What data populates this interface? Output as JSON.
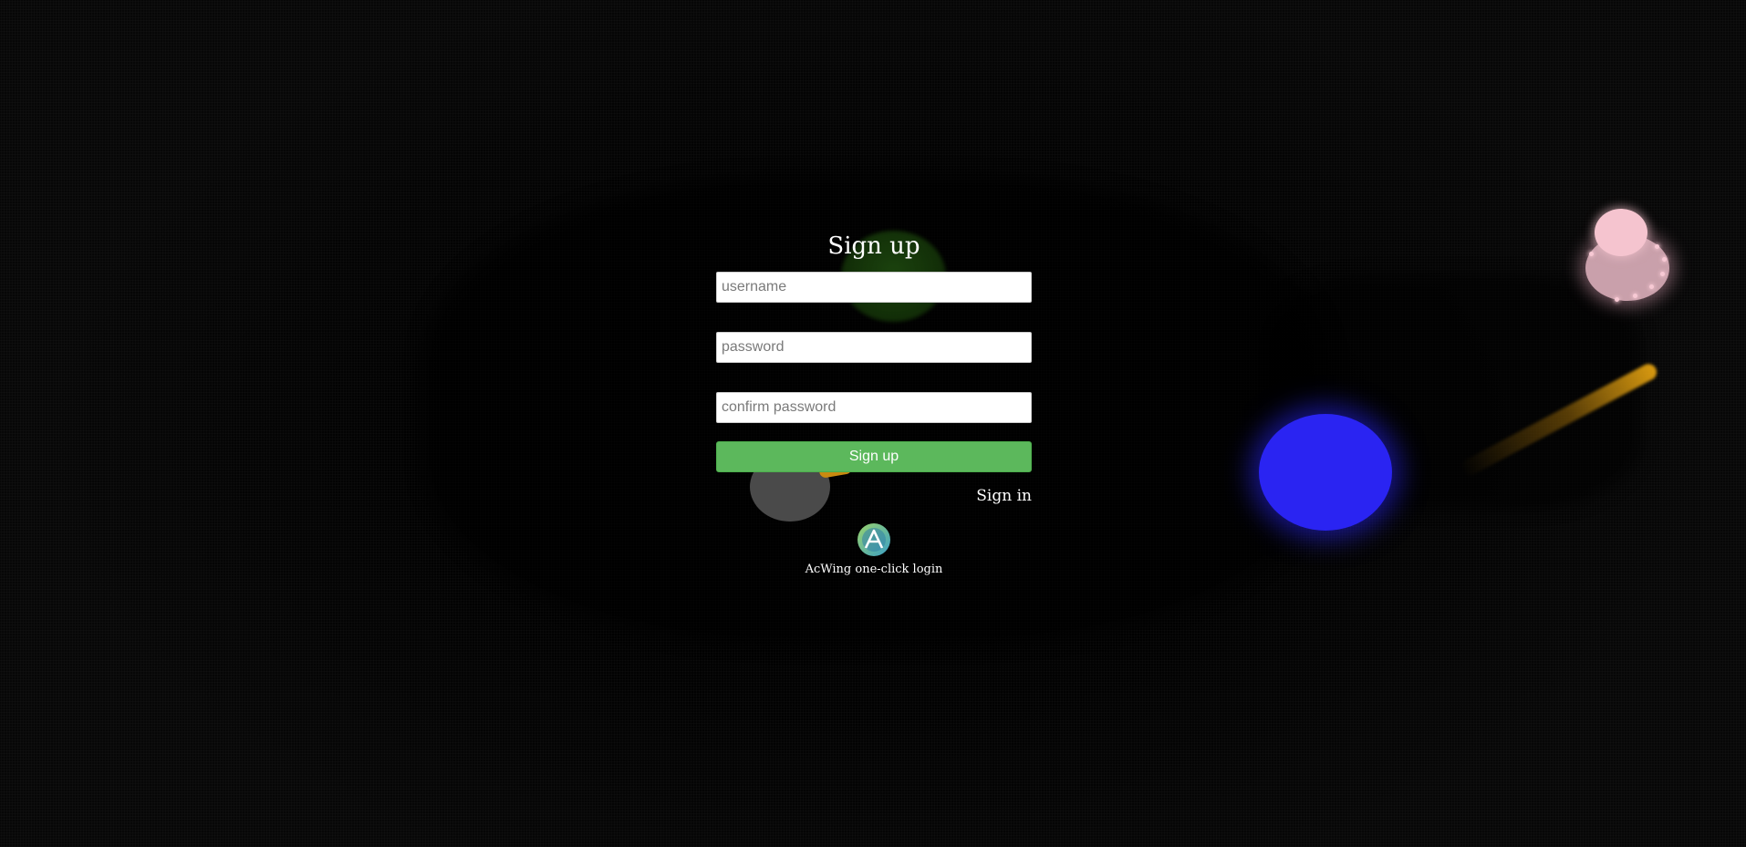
{
  "signup_form": {
    "title": "Sign up",
    "username_placeholder": "username",
    "password_placeholder": "password",
    "confirm_password_placeholder": "confirm password",
    "submit_label": "Sign up",
    "switch_link": "Sign in",
    "oauth_label": "AcWing one-click login",
    "oauth_icon": "acwing-logo-icon"
  },
  "game_scene": {
    "objects": [
      {
        "name": "green-player",
        "color": "#1e4a10"
      },
      {
        "name": "grey-player",
        "color": "#4a4a4a"
      },
      {
        "name": "blue-player",
        "color": "#2a24f2"
      },
      {
        "name": "pink-player",
        "color": "#f5c4cf"
      },
      {
        "name": "fireball",
        "color": "#d99a10"
      }
    ]
  },
  "colors": {
    "background": "#050505",
    "primary_button": "#5cb85c",
    "text": "#ffffff"
  }
}
